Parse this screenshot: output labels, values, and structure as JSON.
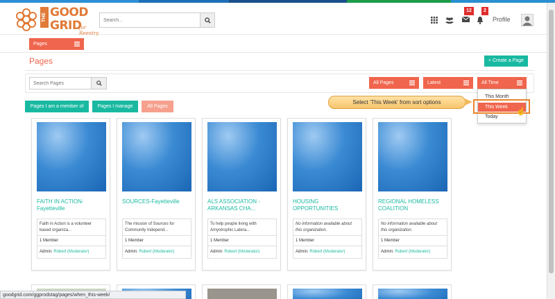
{
  "colors": {
    "accent": "#f0654d",
    "teal": "#19b9a1",
    "brand_orange": "#e07a37",
    "badge_red": "#e02d2d",
    "callout": "#f8c56c",
    "highlight": "#e8842c"
  },
  "header": {
    "logo": {
      "the": "THE",
      "good": "GOOD",
      "grid": "GRID",
      "tagline": "for Reentry"
    },
    "search_placeholder": "Search...",
    "search_icon": "search-icon",
    "icons": [
      "apps-grid-icon",
      "group-icon",
      "mail-icon",
      "bell-icon"
    ],
    "mail_count": "12",
    "notification_count": "2",
    "profile_label": "Profile"
  },
  "subbar": {
    "pages_menu_label": "Pages"
  },
  "main": {
    "title": "Pages",
    "create_label": "+ Create a Page",
    "search_placeholder": "Search Pages",
    "filters": {
      "type_label": "All Pages",
      "order_label": "Latest",
      "time_label": "All Time"
    },
    "time_options": [
      "This Month",
      "This Week",
      "Today"
    ],
    "selected_time_option": "This Week",
    "tabs": [
      "Pages I am a member of",
      "Pages I manage",
      "All Pages"
    ],
    "active_tab": "All Pages"
  },
  "callout": {
    "text": "Select ‘This Week’ from sort options"
  },
  "cards": [
    {
      "title": "FAITH IN ACTION-Fayetteville",
      "desc": "Faith in Action is a volunteer based organiza...",
      "desc_na": false,
      "members": "1 Member",
      "admin_label": "Admin:",
      "admin_name": "Robert (Moderator)"
    },
    {
      "title": "SOURCES-Fayetteville",
      "desc": "The mission of Sources for Community Independ...",
      "desc_na": false,
      "members": "1 Member",
      "admin_label": "Admin:",
      "admin_name": "Robert (Moderator)"
    },
    {
      "title": "ALS ASSOCIATION - ARKANSAS CHA...",
      "desc": "To help people living with Amyotrophic Latera...",
      "desc_na": false,
      "members": "1 Member",
      "admin_label": "Admin:",
      "admin_name": "Robert (Moderator)"
    },
    {
      "title": "HOUSING OPPORTUNITIES",
      "desc": "No information available about this organization.",
      "desc_na": true,
      "members": "1 Member",
      "admin_label": "Admin:",
      "admin_name": "Robert (Moderator)"
    },
    {
      "title": "REGIONAL HOMELESS COALITION",
      "desc": "No information available about this organization.",
      "desc_na": true,
      "members": "1 Member",
      "admin_label": "Admin:",
      "admin_name": "Robert (Moderator)"
    }
  ],
  "status_url": "goodgrid.com/ggprodstag/pages/when_this-week/"
}
